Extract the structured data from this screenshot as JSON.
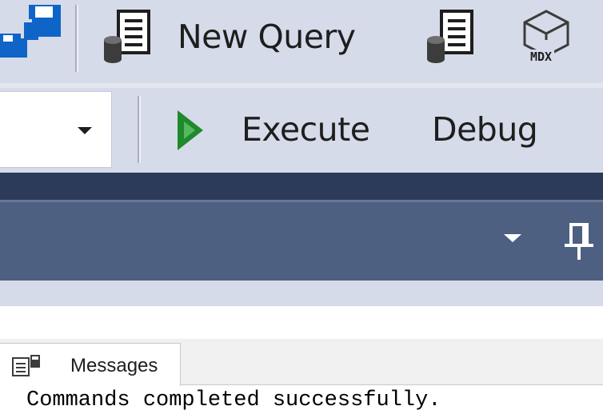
{
  "toolbar": {
    "new_query_label": "New Query",
    "mdx_label": "MDX",
    "icons": [
      "save-all-icon",
      "new-query-icon",
      "database-query-icon",
      "mdx-query-icon"
    ]
  },
  "query_toolbar": {
    "execute_label": "Execute",
    "debug_label": "Debug",
    "execute_icon_color": "#1f8a2b"
  },
  "panel": {
    "icons": [
      "dropdown-arrow-icon",
      "pin-icon"
    ]
  },
  "results": {
    "tabs": [
      {
        "label": "Messages"
      }
    ],
    "message": "Commands completed successfully."
  },
  "colors": {
    "toolbar_bg": "#d6dbe9",
    "title_bar": "#2c3b59",
    "panel_bar": "#4d6082",
    "accent_blue": "#0f64c8"
  }
}
